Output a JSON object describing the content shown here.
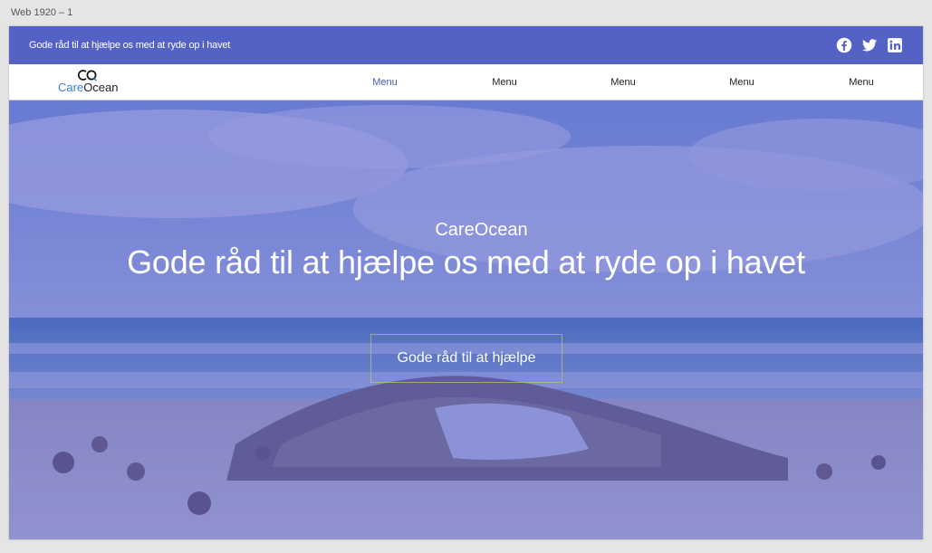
{
  "artboard": {
    "label": "Web 1920 – 1"
  },
  "topbar": {
    "tagline": "Gode råd til at hjælpe os med at ryde op i havet",
    "social": [
      {
        "icon": "facebook-icon"
      },
      {
        "icon": "twitter-icon"
      },
      {
        "icon": "linkedin-icon"
      }
    ]
  },
  "nav": {
    "logo": {
      "part1": "Care",
      "part2": "Ocean"
    },
    "items": [
      {
        "label": "Menu",
        "active": true
      },
      {
        "label": "Menu",
        "active": false
      },
      {
        "label": "Menu",
        "active": false
      },
      {
        "label": "Menu",
        "active": false
      },
      {
        "label": "Menu",
        "active": false
      }
    ]
  },
  "hero": {
    "subtitle": "CareOcean",
    "title": "Gode råd til at hjælpe os med at ryde op i havet",
    "button_label": "Gode råd til at hjælpe"
  },
  "colors": {
    "topbar": "#5462c6",
    "active_menu": "#4a57b5",
    "overlay": "#565ccd"
  }
}
